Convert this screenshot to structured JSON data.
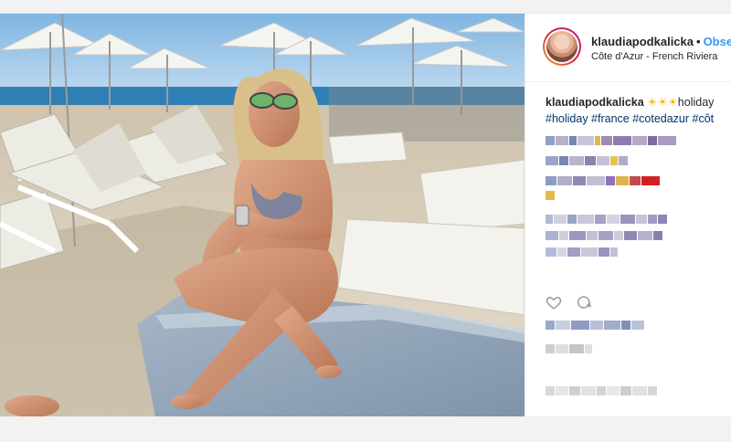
{
  "post": {
    "username": "klaudiapodkalicka",
    "separator": "•",
    "follow_label": "Obse",
    "location": "Côte d'Azur - French Riviera",
    "caption": {
      "user": "klaudiapodkalicka",
      "emoji": "☀☀☀",
      "text": "holiday",
      "tags": "#holiday #france #cotedazur #côt"
    }
  },
  "icons": {
    "like": "heart-icon",
    "comment": "comment-icon"
  },
  "colors": {
    "link": "#3897f0",
    "tag": "#003569",
    "text": "#262626"
  }
}
